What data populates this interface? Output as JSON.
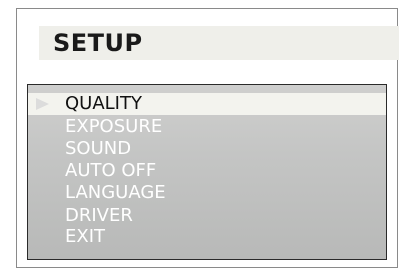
{
  "title": "SETUP",
  "menu": {
    "items": [
      {
        "label": "QUALITY",
        "selected": true
      },
      {
        "label": "EXPOSURE",
        "selected": false
      },
      {
        "label": "SOUND",
        "selected": false
      },
      {
        "label": "AUTO OFF",
        "selected": false
      },
      {
        "label": "LANGUAGE",
        "selected": false
      },
      {
        "label": "DRIVER",
        "selected": false
      },
      {
        "label": "EXIT",
        "selected": false
      }
    ]
  },
  "colors": {
    "title_bar": "#efefea",
    "menu_background": "#c4c5c4",
    "selected_highlight": "#f3f3ee",
    "item_text": "#ffffff",
    "selected_text": "#111111"
  },
  "icons": {
    "selector": "triangle-right-icon"
  }
}
